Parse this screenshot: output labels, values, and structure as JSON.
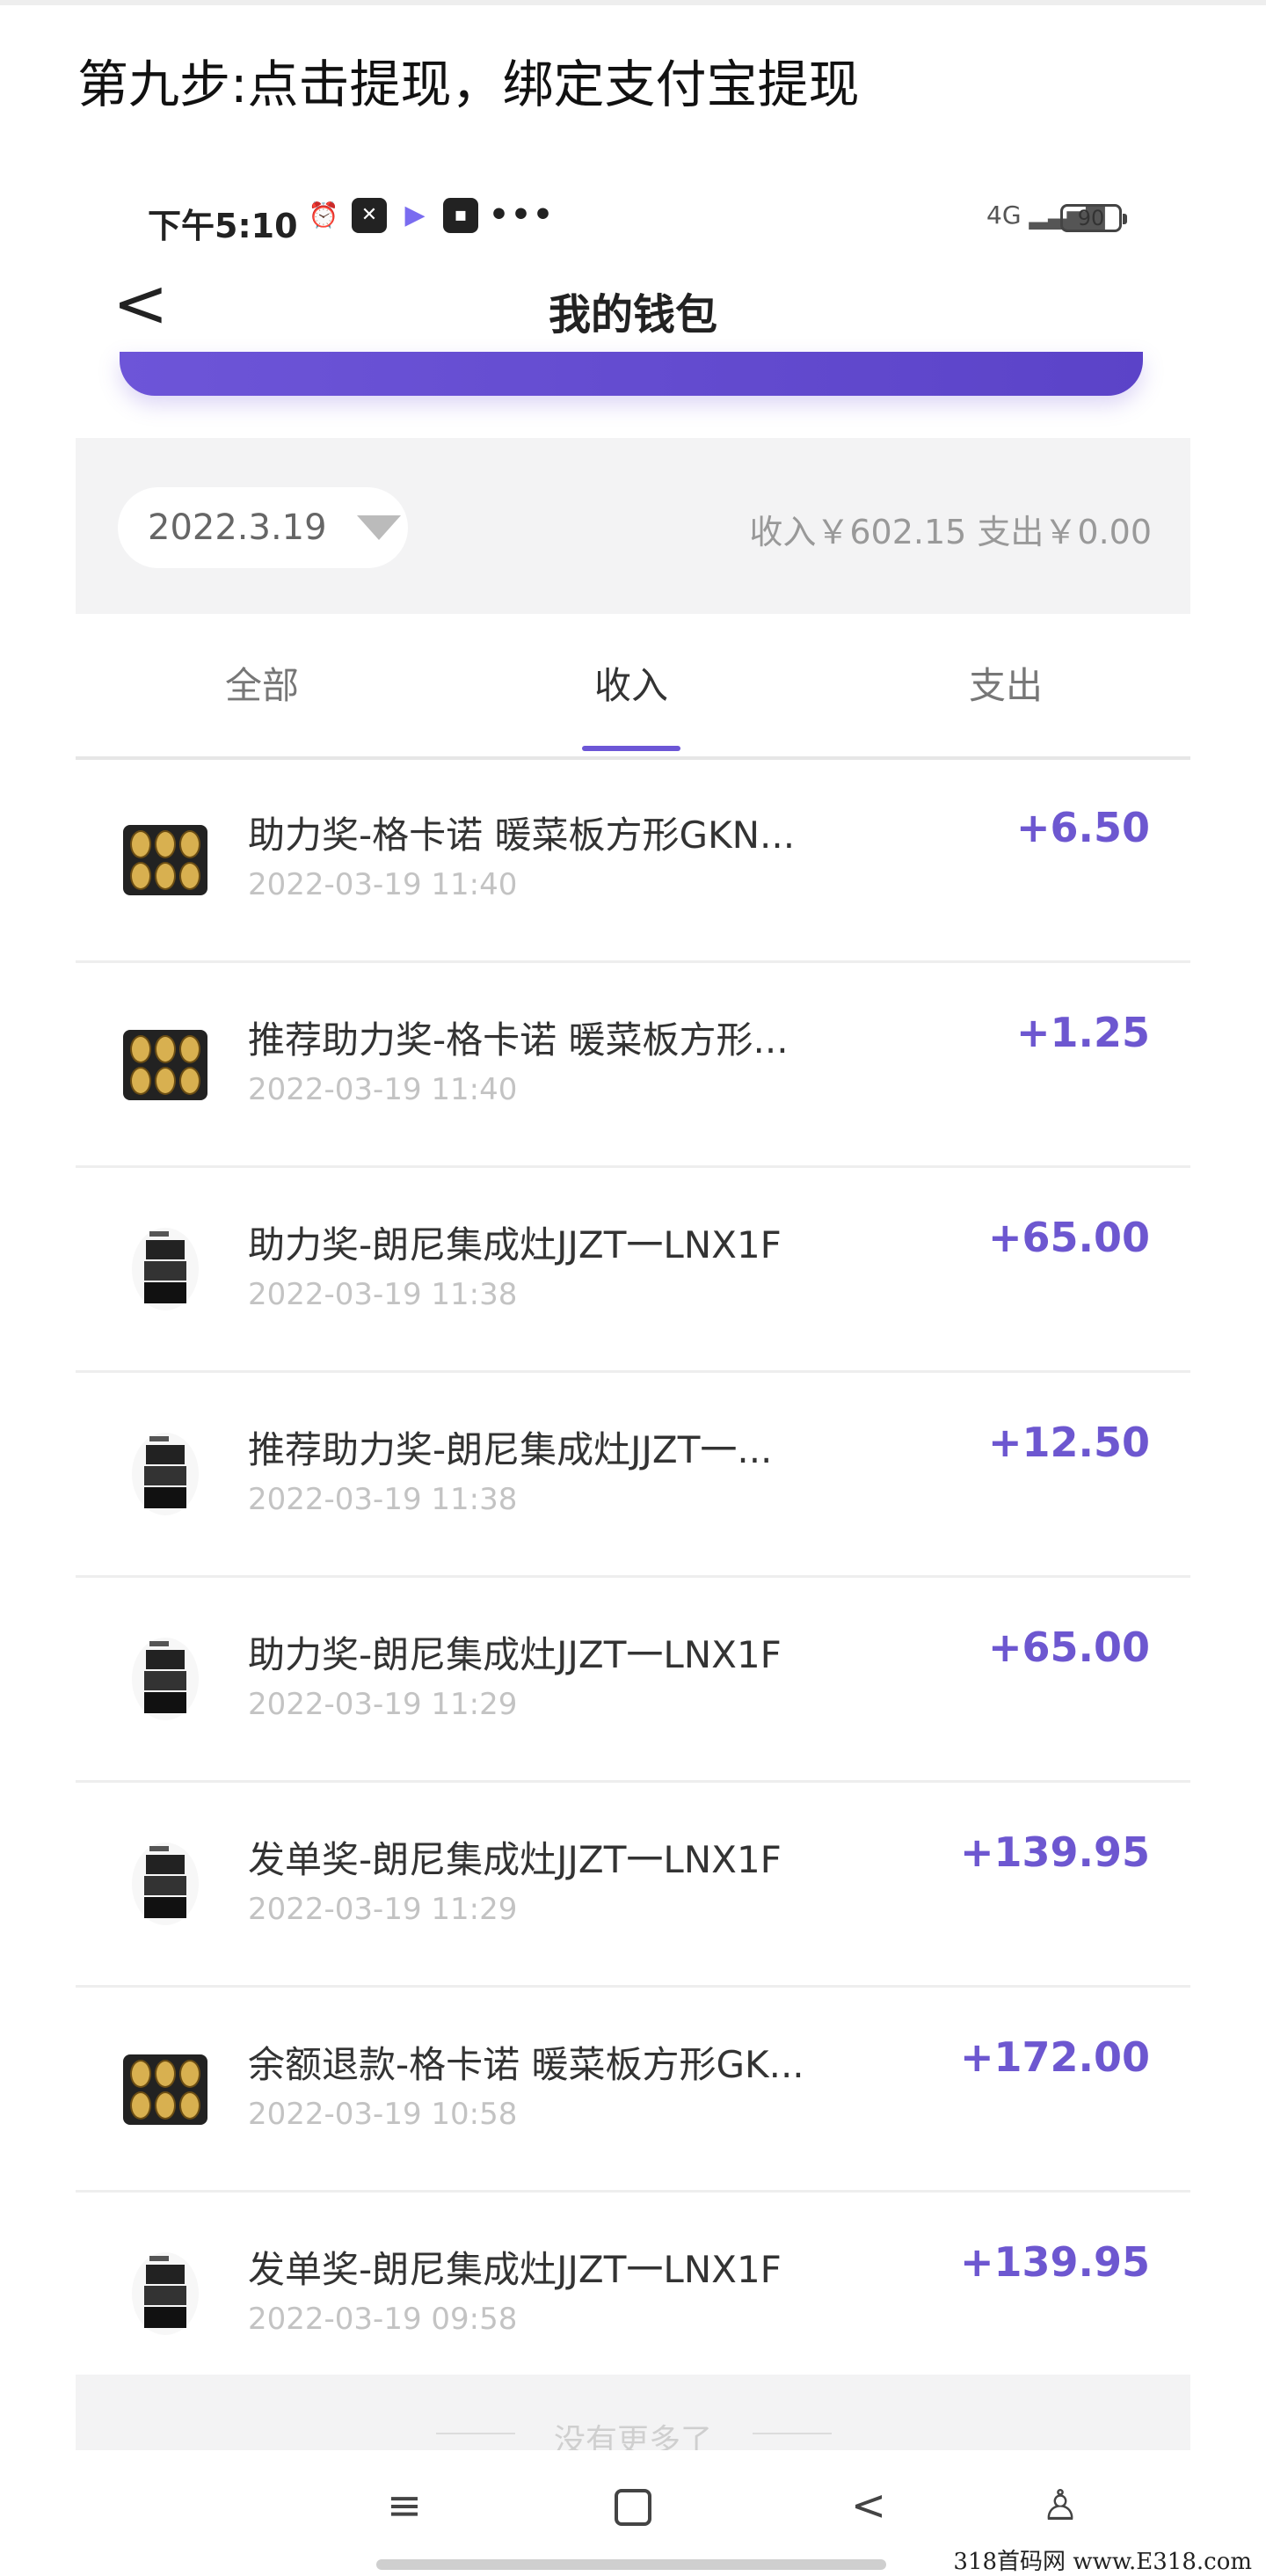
{
  "caption": "第九步:点击提现，绑定支付宝提现",
  "status_bar": {
    "time": "下午5:10",
    "icons": [
      "alarm-icon",
      "app-icon",
      "play-icon",
      "app2-icon"
    ],
    "more": "•••",
    "signal": "4G",
    "battery": "90"
  },
  "header": {
    "back_glyph": "<",
    "title": "我的钱包"
  },
  "filter": {
    "date": "2022.3.19",
    "summary": "收入￥602.15 支出￥0.00"
  },
  "tabs": [
    {
      "label": "全部"
    },
    {
      "label": "收入"
    },
    {
      "label": "支出"
    }
  ],
  "transactions": [
    {
      "title": "助力奖-格卡诺 暖菜板方形GKN...",
      "time": "2022-03-19 11:40",
      "amount": "+6.50",
      "thumb": "warming-plate"
    },
    {
      "title": "推荐助力奖-格卡诺 暖菜板方形...",
      "time": "2022-03-19 11:40",
      "amount": "+1.25",
      "thumb": "warming-plate"
    },
    {
      "title": "助力奖-朗尼集成灶JJZT一LNX1F",
      "time": "2022-03-19 11:38",
      "amount": "+65.00",
      "thumb": "stove"
    },
    {
      "title": "推荐助力奖-朗尼集成灶JJZT一...",
      "time": "2022-03-19 11:38",
      "amount": "+12.50",
      "thumb": "stove"
    },
    {
      "title": "助力奖-朗尼集成灶JJZT一LNX1F",
      "time": "2022-03-19 11:29",
      "amount": "+65.00",
      "thumb": "stove"
    },
    {
      "title": "发单奖-朗尼集成灶JJZT一LNX1F",
      "time": "2022-03-19 11:29",
      "amount": "+139.95",
      "thumb": "stove"
    },
    {
      "title": "余额退款-格卡诺 暖菜板方形GK...",
      "time": "2022-03-19 10:58",
      "amount": "+172.00",
      "thumb": "warming-plate"
    },
    {
      "title": "发单奖-朗尼集成灶JJZT一LNX1F",
      "time": "2022-03-19 09:58",
      "amount": "+139.95",
      "thumb": "stove"
    }
  ],
  "footer": {
    "no_more": "没有更多了"
  },
  "nav": {
    "menu_glyph": "≡",
    "back_glyph": "<",
    "access_glyph": "♙"
  },
  "watermark": "318首码网 www.E318.com",
  "colors": {
    "accent": "#6d57d0",
    "amount": "#6d57d0",
    "filter_bg": "#f3f3f4"
  }
}
